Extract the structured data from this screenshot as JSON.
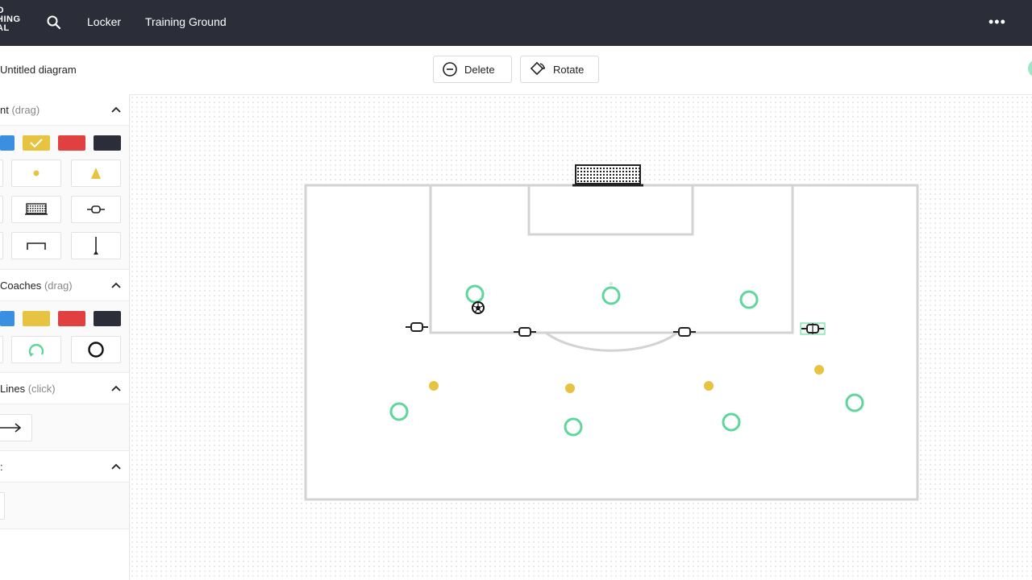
{
  "nav": {
    "logo_lines": [
      "O",
      "HING",
      "AL"
    ],
    "links": [
      "Locker",
      "Training Ground"
    ],
    "more": "•••"
  },
  "toolbar": {
    "title": "Untitled diagram",
    "delete_label": "Delete",
    "rotate_label": "Rotate"
  },
  "sidebar": {
    "equipment": {
      "label": "nt",
      "hint": "(drag)"
    },
    "players": {
      "label": "Coaches",
      "hint": "(drag)"
    },
    "lines": {
      "label": "Lines",
      "hint": "(click)"
    },
    "fourth": {
      "label": ":"
    }
  },
  "colors": {
    "blue": "#3b8fe0",
    "yellow": "#e6c441",
    "red": "#e04040",
    "dark": "#2b2d38",
    "green": "#5fd69b",
    "pitch_line": "#d3d3d3"
  },
  "icons": {
    "search": "search-icon",
    "delete": "minus-circle-icon",
    "rotate": "rotate-icon",
    "chevron": "chevron-up-icon",
    "more": "more-horizontal-icon"
  }
}
